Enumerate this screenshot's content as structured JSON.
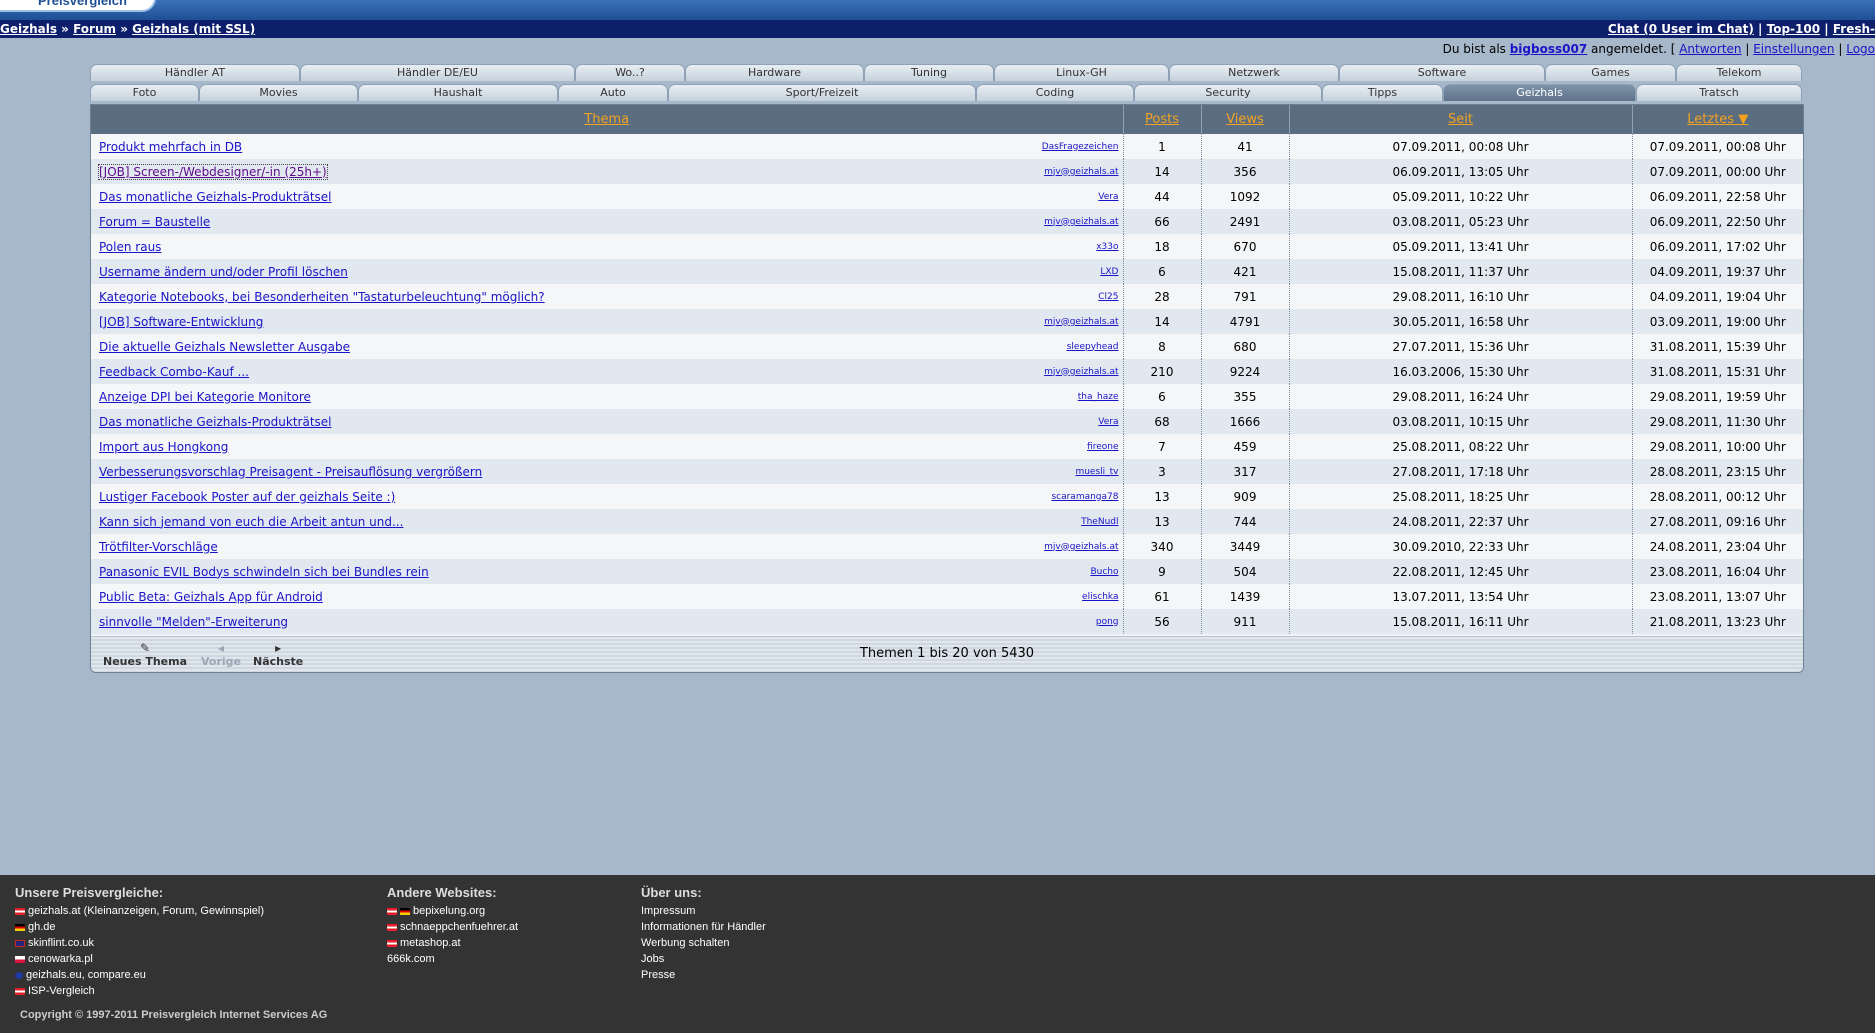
{
  "header": {
    "logo_text": "Preisvergleich"
  },
  "navbar": {
    "crumbs": [
      "Geizhals",
      "Forum",
      "Geizhals (mit SSL)"
    ],
    "separator": " » ",
    "links": [
      "Chat (0 User im Chat)",
      "Top-100",
      "Fresh-"
    ],
    "link_sep": " | "
  },
  "userbar": {
    "prefix": "Du bist als ",
    "user": "bigboss007",
    "suffix": " angemeldet. [ ",
    "links": [
      "Antworten",
      "Einstellungen",
      "Logo"
    ]
  },
  "tabs_row1": [
    "Händler AT",
    "Händler DE/EU",
    "Wo..?",
    "Hardware",
    "Tuning",
    "Linux-GH",
    "Netzwerk",
    "Software",
    "Games",
    "Telekom"
  ],
  "tabs_row2": [
    "Foto",
    "Movies",
    "Haushalt",
    "Auto",
    "Sport/Freizeit",
    "Coding",
    "Security",
    "Tipps",
    "Geizhals",
    "Tratsch"
  ],
  "active_tab": "Geizhals",
  "table": {
    "headers": {
      "thema": "Thema",
      "posts": "Posts",
      "views": "Views",
      "seit": "Seit",
      "letztes": "Letztes ▼"
    },
    "rows": [
      {
        "title": "Produkt mehrfach in DB",
        "author": "DasFragezeichen",
        "posts": "1",
        "views": "41",
        "seit": "07.09.2011, 00:08 Uhr",
        "letztes": "07.09.2011, 00:08 Uhr"
      },
      {
        "title": "[JOB] Screen-/Webdesigner/-in (25h+)",
        "author": "mjv@geizhals.at",
        "posts": "14",
        "views": "356",
        "seit": "06.09.2011, 13:05 Uhr",
        "letztes": "07.09.2011, 00:00 Uhr"
      },
      {
        "title": "Das monatliche Geizhals-Produkträtsel",
        "author": "Vera",
        "posts": "44",
        "views": "1092",
        "seit": "05.09.2011, 10:22 Uhr",
        "letztes": "06.09.2011, 22:58 Uhr"
      },
      {
        "title": "Forum = Baustelle",
        "author": "mjv@geizhals.at",
        "posts": "66",
        "views": "2491",
        "seit": "03.08.2011, 05:23 Uhr",
        "letztes": "06.09.2011, 22:50 Uhr"
      },
      {
        "title": "Polen raus",
        "author": "x33o",
        "posts": "18",
        "views": "670",
        "seit": "05.09.2011, 13:41 Uhr",
        "letztes": "06.09.2011, 17:02 Uhr"
      },
      {
        "title": "Username ändern und/oder Profil löschen",
        "author": "LXD",
        "posts": "6",
        "views": "421",
        "seit": "15.08.2011, 11:37 Uhr",
        "letztes": "04.09.2011, 19:37 Uhr"
      },
      {
        "title": "Kategorie Notebooks, bei Besonderheiten \"Tastaturbeleuchtung\" möglich?",
        "author": "Cl25",
        "posts": "28",
        "views": "791",
        "seit": "29.08.2011, 16:10 Uhr",
        "letztes": "04.09.2011, 19:04 Uhr"
      },
      {
        "title": "[JOB] Software-Entwicklung",
        "author": "mjv@geizhals.at",
        "posts": "14",
        "views": "4791",
        "seit": "30.05.2011, 16:58 Uhr",
        "letztes": "03.09.2011, 19:00 Uhr"
      },
      {
        "title": "Die aktuelle Geizhals Newsletter Ausgabe",
        "author": "sleepyhead",
        "posts": "8",
        "views": "680",
        "seit": "27.07.2011, 15:36 Uhr",
        "letztes": "31.08.2011, 15:39 Uhr"
      },
      {
        "title": "Feedback Combo-Kauf ...",
        "author": "mjv@geizhals.at",
        "posts": "210",
        "views": "9224",
        "seit": "16.03.2006, 15:30 Uhr",
        "letztes": "31.08.2011, 15:31 Uhr"
      },
      {
        "title": "Anzeige DPI bei Kategorie Monitore",
        "author": "tha_haze",
        "posts": "6",
        "views": "355",
        "seit": "29.08.2011, 16:24 Uhr",
        "letztes": "29.08.2011, 19:59 Uhr"
      },
      {
        "title": "Das monatliche Geizhals-Produkträtsel",
        "author": "Vera",
        "posts": "68",
        "views": "1666",
        "seit": "03.08.2011, 10:15 Uhr",
        "letztes": "29.08.2011, 11:30 Uhr"
      },
      {
        "title": "Import aus Hongkong",
        "author": "fireone",
        "posts": "7",
        "views": "459",
        "seit": "25.08.2011, 08:22 Uhr",
        "letztes": "29.08.2011, 10:00 Uhr"
      },
      {
        "title": "Verbesserungsvorschlag Preisagent - Preisauflösung vergrößern",
        "author": "muesli_tv",
        "posts": "3",
        "views": "317",
        "seit": "27.08.2011, 17:18 Uhr",
        "letztes": "28.08.2011, 23:15 Uhr"
      },
      {
        "title": "Lustiger Facebook Poster auf der geizhals Seite :)",
        "author": "scaramanga78",
        "posts": "13",
        "views": "909",
        "seit": "25.08.2011, 18:25 Uhr",
        "letztes": "28.08.2011, 00:12 Uhr"
      },
      {
        "title": "Kann sich jemand von euch die Arbeit antun und...",
        "author": "TheNudl",
        "posts": "13",
        "views": "744",
        "seit": "24.08.2011, 22:37 Uhr",
        "letztes": "27.08.2011, 09:16 Uhr"
      },
      {
        "title": "Trötfilter-Vorschläge",
        "author": "mjv@geizhals.at",
        "posts": "340",
        "views": "3449",
        "seit": "30.09.2010, 22:33 Uhr",
        "letztes": "24.08.2011, 23:04 Uhr"
      },
      {
        "title": "Panasonic EVIL Bodys schwindeln sich bei Bundles rein",
        "author": "Bucho",
        "posts": "9",
        "views": "504",
        "seit": "22.08.2011, 12:45 Uhr",
        "letztes": "23.08.2011, 16:04 Uhr"
      },
      {
        "title": "Public Beta: Geizhals App für Android",
        "author": "elischka",
        "posts": "61",
        "views": "1439",
        "seit": "13.07.2011, 13:54 Uhr",
        "letztes": "23.08.2011, 13:07 Uhr"
      },
      {
        "title": "sinnvolle \"Melden\"-Erweiterung",
        "author": "pong",
        "posts": "56",
        "views": "911",
        "seit": "15.08.2011, 16:11 Uhr",
        "letztes": "21.08.2011, 13:23 Uhr"
      }
    ]
  },
  "forum_footer": {
    "new_topic": "Neues Thema",
    "prev": "Vorige",
    "next": "Nächste",
    "page_info": "Themen 1 bis 20 von 5430"
  },
  "footer": {
    "col1": {
      "title": "Unsere Preisvergleiche:",
      "items": [
        {
          "flag": "at",
          "text": "geizhals.at (Kleinanzeigen, Forum, Gewinnspiel)"
        },
        {
          "flag": "de",
          "text": "gh.de"
        },
        {
          "flag": "uk",
          "text": "skinflint.co.uk"
        },
        {
          "flag": "pl",
          "text": "cenowarka.pl"
        },
        {
          "flag": "eu",
          "text": "geizhals.eu, compare.eu"
        },
        {
          "flag": "at",
          "text": "ISP-Vergleich"
        }
      ]
    },
    "col2": {
      "title": "Andere Websites:",
      "items": [
        {
          "flag": "at-de",
          "text": "bepixelung.org"
        },
        {
          "flag": "at",
          "text": "schnaeppchenfuehrer.at"
        },
        {
          "flag": "at",
          "text": "metashop.at"
        },
        {
          "flag": "",
          "text": "666k.com"
        }
      ]
    },
    "col3": {
      "title": "Über uns:",
      "items": [
        "Impressum",
        "Informationen für Händler",
        "Werbung schalten",
        "Jobs",
        "Presse"
      ]
    },
    "copyright": "Copyright © 1997-2011 Preisvergleich Internet Services AG"
  }
}
